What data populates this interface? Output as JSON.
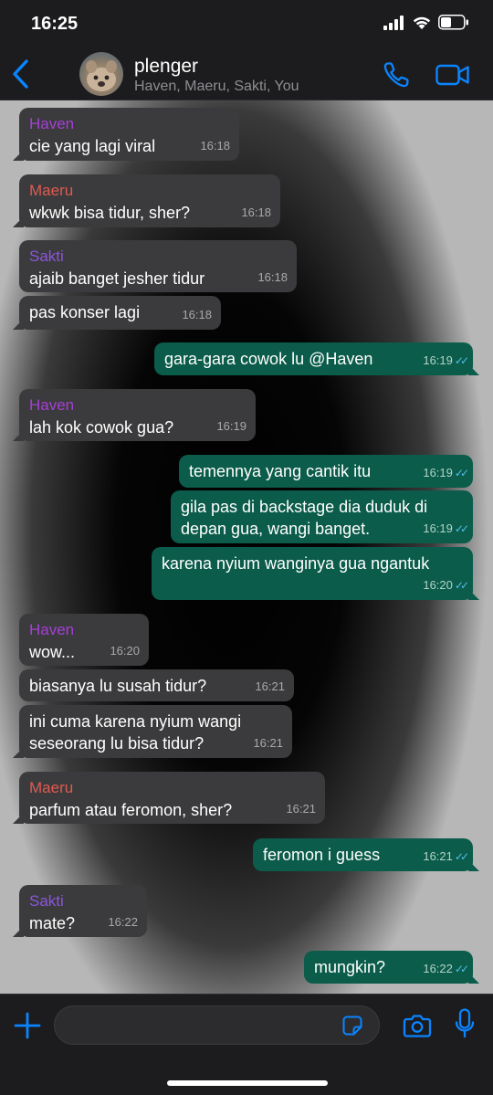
{
  "status_bar": {
    "time": "16:25"
  },
  "header": {
    "title": "plenger",
    "subtitle": "Haven, Maeru, Sakti, You"
  },
  "colors": {
    "accent": "#0a84ff",
    "incoming_bubble": "#3b3b3d",
    "outgoing_bubble": "#0b5c4a",
    "read_ticks": "#53bdeb",
    "sender_haven": "#a63fd6",
    "sender_maeru": "#e05a50",
    "sender_sakti": "#8b56d9"
  },
  "messages": [
    {
      "direction": "in",
      "sender": "Haven",
      "text": "cie yang lagi viral",
      "time": "16:18"
    },
    {
      "direction": "in",
      "sender": "Maeru",
      "text": "wkwk bisa tidur, sher?",
      "time": "16:18"
    },
    {
      "direction": "in",
      "sender": "Sakti",
      "text": "ajaib banget jesher tidur",
      "time": "16:18"
    },
    {
      "direction": "in",
      "sender": "",
      "text": "pas konser lagi",
      "time": "16:18"
    },
    {
      "direction": "out",
      "sender": "",
      "text": "gara-gara cowok lu @Haven",
      "time": "16:19"
    },
    {
      "direction": "in",
      "sender": "Haven",
      "text": "lah kok cowok gua?",
      "time": "16:19"
    },
    {
      "direction": "out",
      "sender": "",
      "text": "temennya yang cantik itu",
      "time": "16:19"
    },
    {
      "direction": "out",
      "sender": "",
      "text": "gila pas di backstage dia duduk di depan gua, wangi banget.",
      "time": "16:19"
    },
    {
      "direction": "out",
      "sender": "",
      "text": "karena nyium wanginya gua ngantuk",
      "time": "16:20"
    },
    {
      "direction": "in",
      "sender": "Haven",
      "text": "wow...",
      "time": "16:20"
    },
    {
      "direction": "in",
      "sender": "",
      "text": "biasanya lu susah tidur?",
      "time": "16:21"
    },
    {
      "direction": "in",
      "sender": "",
      "text": "ini cuma karena nyium wangi seseorang lu bisa tidur?",
      "time": "16:21"
    },
    {
      "direction": "in",
      "sender": "Maeru",
      "text": "parfum atau feromon, sher?",
      "time": "16:21"
    },
    {
      "direction": "out",
      "sender": "",
      "text": "feromon i guess",
      "time": "16:21"
    },
    {
      "direction": "in",
      "sender": "Sakti",
      "text": "mate?",
      "time": "16:22"
    },
    {
      "direction": "out",
      "sender": "",
      "text": "mungkin?",
      "time": "16:22"
    }
  ],
  "input": {
    "value": "",
    "placeholder": ""
  },
  "icons": {
    "back": "chevron-left-icon",
    "call": "phone-icon",
    "video": "video-camera-icon",
    "attach": "plus-icon",
    "sticker": "sticker-icon",
    "camera": "camera-icon",
    "mic": "microphone-icon"
  }
}
